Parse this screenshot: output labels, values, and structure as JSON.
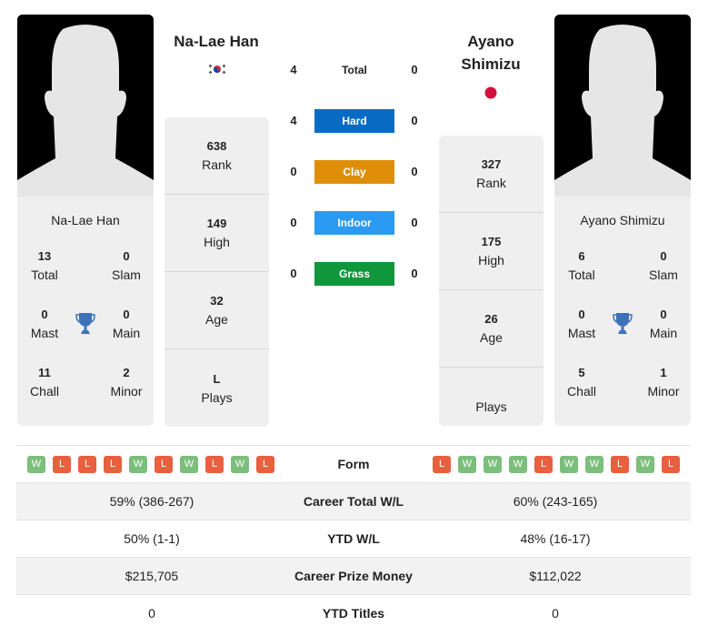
{
  "player1": {
    "name": "Na-Lae Han",
    "country_flag": "south-korea-flag",
    "card_name": "Na-Lae Han",
    "titles": {
      "total": {
        "value": "13",
        "label": "Total"
      },
      "slam": {
        "value": "0",
        "label": "Slam"
      },
      "mast": {
        "value": "0",
        "label": "Mast"
      },
      "main": {
        "value": "0",
        "label": "Main"
      },
      "chall": {
        "value": "11",
        "label": "Chall"
      },
      "minor": {
        "value": "2",
        "label": "Minor"
      }
    },
    "stats": {
      "rank": {
        "value": "638",
        "label": "Rank"
      },
      "high": {
        "value": "149",
        "label": "High"
      },
      "age": {
        "value": "32",
        "label": "Age"
      },
      "plays": {
        "value": "L",
        "label": "Plays"
      }
    },
    "form": [
      "W",
      "L",
      "L",
      "L",
      "W",
      "L",
      "W",
      "L",
      "W",
      "L"
    ]
  },
  "player2": {
    "name_line1": "Ayano",
    "name_line2": "Shimizu",
    "country_flag": "japan-flag",
    "card_name": "Ayano Shimizu",
    "titles": {
      "total": {
        "value": "6",
        "label": "Total"
      },
      "slam": {
        "value": "0",
        "label": "Slam"
      },
      "mast": {
        "value": "0",
        "label": "Mast"
      },
      "main": {
        "value": "0",
        "label": "Main"
      },
      "chall": {
        "value": "5",
        "label": "Chall"
      },
      "minor": {
        "value": "1",
        "label": "Minor"
      }
    },
    "stats": {
      "rank": {
        "value": "327",
        "label": "Rank"
      },
      "high": {
        "value": "175",
        "label": "High"
      },
      "age": {
        "value": "26",
        "label": "Age"
      },
      "plays": {
        "value": "",
        "label": "Plays"
      }
    },
    "form": [
      "L",
      "W",
      "W",
      "W",
      "L",
      "W",
      "W",
      "L",
      "W",
      "L"
    ]
  },
  "h2h": [
    {
      "label": "Total",
      "p1": "4",
      "p2": "0",
      "color": null
    },
    {
      "label": "Hard",
      "p1": "4",
      "p2": "0",
      "color": "#0a6bc4"
    },
    {
      "label": "Clay",
      "p1": "0",
      "p2": "0",
      "color": "#df8e0a"
    },
    {
      "label": "Indoor",
      "p1": "0",
      "p2": "0",
      "color": "#2b9af2"
    },
    {
      "label": "Grass",
      "p1": "0",
      "p2": "0",
      "color": "#11973b"
    }
  ],
  "comparison": {
    "form_label": "Form",
    "rows": [
      {
        "label": "Career Total W/L",
        "p1": "59% (386-267)",
        "p2": "60% (243-165)"
      },
      {
        "label": "YTD W/L",
        "p1": "50% (1-1)",
        "p2": "48% (16-17)"
      },
      {
        "label": "Career Prize Money",
        "p1": "$215,705",
        "p2": "$112,022"
      },
      {
        "label": "YTD Titles",
        "p1": "0",
        "p2": "0"
      }
    ]
  },
  "colors": {
    "win": "#7cbe7c",
    "loss": "#e8603f",
    "trophy": "#3d72b8"
  }
}
